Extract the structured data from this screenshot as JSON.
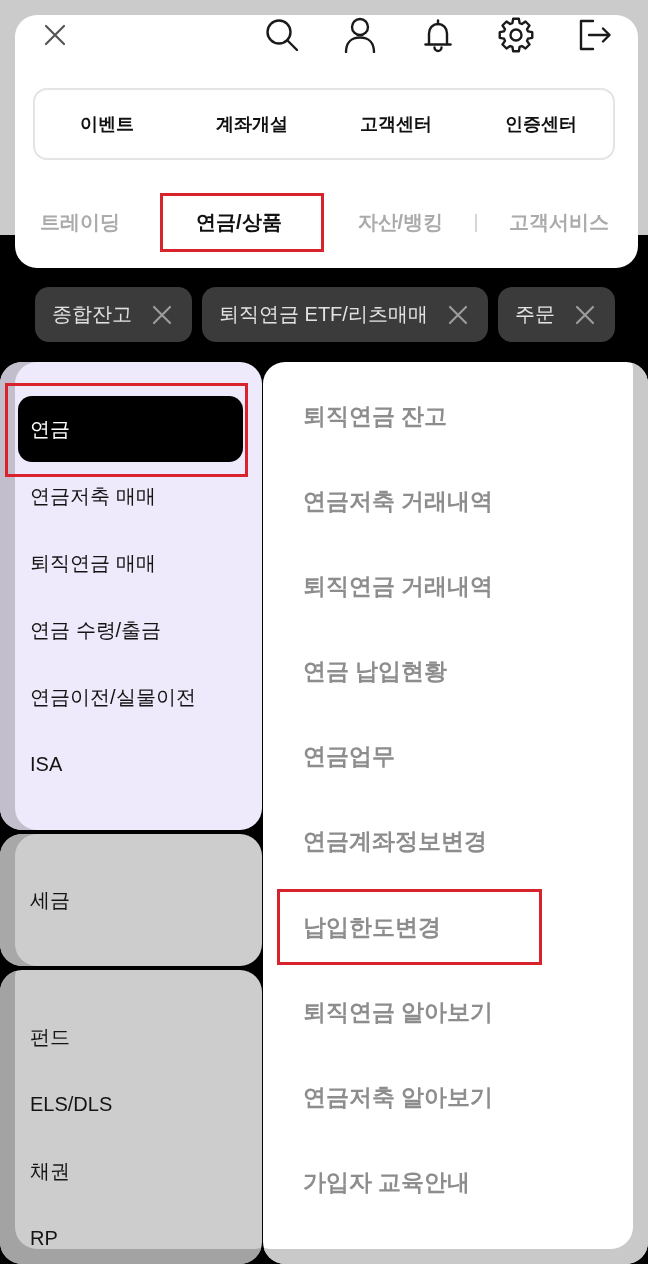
{
  "quick_menu": [
    "이벤트",
    "계좌개설",
    "고객센터",
    "인증센터"
  ],
  "tabs": [
    {
      "label": "트레이딩",
      "selected": false,
      "highlighted": false,
      "divider_before": false
    },
    {
      "label": "연금/상품",
      "selected": true,
      "highlighted": true,
      "divider_before": false
    },
    {
      "label": "자산/뱅킹",
      "selected": false,
      "highlighted": false,
      "divider_before": false
    },
    {
      "label": "고객서비스",
      "selected": false,
      "highlighted": false,
      "divider_before": true
    }
  ],
  "open_tabs": [
    {
      "label": "종합잔고"
    },
    {
      "label": "퇴직연금 ETF/리츠매매"
    },
    {
      "label": "주문"
    }
  ],
  "categories": [
    {
      "selected": true,
      "items": [
        {
          "label": "연금",
          "selected": true,
          "highlighted": true
        },
        {
          "label": "연금저축 매매",
          "selected": false,
          "highlighted": false
        },
        {
          "label": "퇴직연금 매매",
          "selected": false,
          "highlighted": false
        },
        {
          "label": "연금 수령/출금",
          "selected": false,
          "highlighted": false
        },
        {
          "label": "연금이전/실물이전",
          "selected": false,
          "highlighted": false
        },
        {
          "label": "ISA",
          "selected": false,
          "highlighted": false
        }
      ]
    },
    {
      "selected": false,
      "items": [
        {
          "label": "세금",
          "selected": false,
          "highlighted": false
        }
      ]
    },
    {
      "selected": false,
      "items": [
        {
          "label": "펀드",
          "selected": false,
          "highlighted": false
        },
        {
          "label": "ELS/DLS",
          "selected": false,
          "highlighted": false
        },
        {
          "label": "채권",
          "selected": false,
          "highlighted": false
        },
        {
          "label": "RP",
          "selected": false,
          "highlighted": false
        }
      ]
    }
  ],
  "submenu": [
    {
      "label": "퇴직연금 잔고",
      "highlighted": false
    },
    {
      "label": "연금저축 거래내역",
      "highlighted": false
    },
    {
      "label": "퇴직연금 거래내역",
      "highlighted": false
    },
    {
      "label": "연금 납입현황",
      "highlighted": false
    },
    {
      "label": "연금업무",
      "highlighted": false
    },
    {
      "label": "연금계좌정보변경",
      "highlighted": false
    },
    {
      "label": "납입한도변경",
      "highlighted": true
    },
    {
      "label": "퇴직연금 알아보기",
      "highlighted": false
    },
    {
      "label": "연금저축 알아보기",
      "highlighted": false
    },
    {
      "label": "가입자 교육안내",
      "highlighted": false
    }
  ]
}
